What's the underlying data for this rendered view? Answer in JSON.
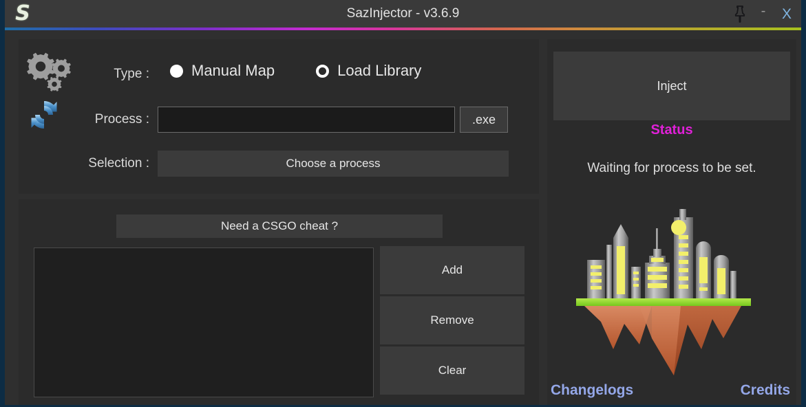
{
  "window": {
    "title": "SazInjector - v3.6.9",
    "logo_letter": "S",
    "border_color": "#0d2c44",
    "background": "#2f2f2f",
    "titlebar_background": "#3a3a3a",
    "accent_gradient": [
      "#1f6fa8",
      "#7d2fc9",
      "#c42bd0",
      "#d4674e",
      "#a8c21e"
    ]
  },
  "titlebar_controls": {
    "pin": "pin-icon",
    "minimize": "-",
    "close": "X"
  },
  "form": {
    "type_label": "Type :",
    "options": [
      {
        "label": "Manual Map",
        "selected": true
      },
      {
        "label": "Load Library",
        "selected": false
      }
    ],
    "process_label": "Process :",
    "process_value": "",
    "process_placeholder": "",
    "exe_suffix": ".exe",
    "selection_label": "Selection :",
    "selection_value": "Choose a process"
  },
  "dll_section": {
    "promo_label": "Need a CSGO cheat ?",
    "list_items": [],
    "buttons": {
      "add": "Add",
      "remove": "Remove",
      "clear": "Clear"
    }
  },
  "right_panel": {
    "inject_label": "Inject",
    "status_title": "Status",
    "status_title_color": "#e020d8",
    "status_text": "Waiting for process to be set.",
    "logo_name": "floating-island-city-logo",
    "links": {
      "changelogs": "Changelogs",
      "credits": "Credits",
      "link_color": "#94a7e8"
    }
  }
}
